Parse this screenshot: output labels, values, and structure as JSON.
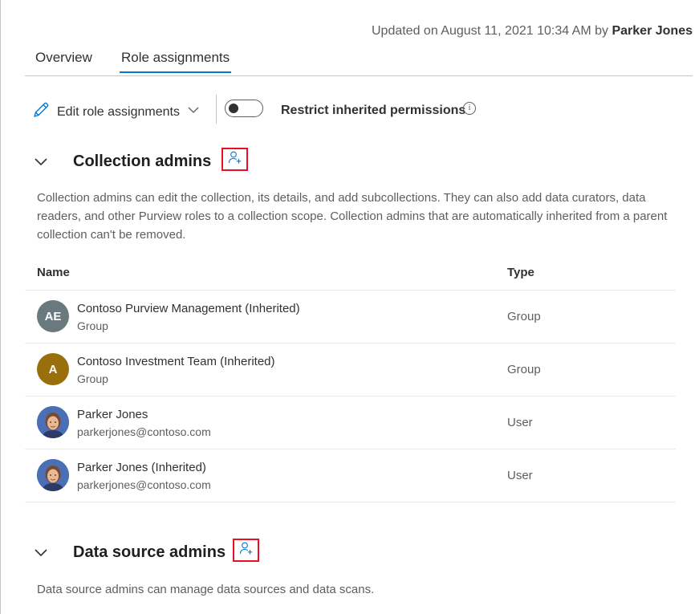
{
  "header": {
    "updated_prefix": "Updated on August 11, 2021 10:34 AM by",
    "updated_by": "Parker Jones"
  },
  "tabs": [
    {
      "label": "Overview",
      "selected": false
    },
    {
      "label": "Role assignments",
      "selected": true
    }
  ],
  "toolbar": {
    "edit_label": "Edit role assignments",
    "edit_icon": "pencil-icon",
    "dropdown_icon": "chevron-down-icon",
    "toggle_state": "off",
    "restrict_label": "Restrict inherited permissions",
    "info_symbol": "i"
  },
  "sections": [
    {
      "title": "Collection admins",
      "description": "Collection admins can edit the collection, its details, and add subcollections. They can also add data curators, data readers, and other Purview roles to a collection scope. Collection admins that are automatically inherited from a parent collection can't be removed."
    },
    {
      "title": "Data source admins",
      "description": "Data source admins can manage data sources and data scans."
    }
  ],
  "table": {
    "headers": {
      "name": "Name",
      "type": "Type"
    },
    "rows": [
      {
        "initials": "AE",
        "name": "Contoso Purview Management (Inherited)",
        "sub": "Group",
        "type": "Group",
        "avatar_color": "#69797e"
      },
      {
        "initials": "A",
        "name": "Contoso Investment Team (Inherited)",
        "sub": "Group",
        "type": "Group",
        "avatar_color": "#986f0b"
      },
      {
        "initials": "",
        "name": "Parker Jones",
        "sub": "parkerjones@contoso.com",
        "type": "User",
        "avatar_color": "#4a6fb5"
      },
      {
        "initials": "",
        "name": "Parker Jones (Inherited)",
        "sub": "parkerjones@contoso.com",
        "type": "User",
        "avatar_color": "#4a6fb5"
      }
    ]
  },
  "colors": {
    "accent": "#0078d4",
    "highlight_box": "#e81123"
  }
}
